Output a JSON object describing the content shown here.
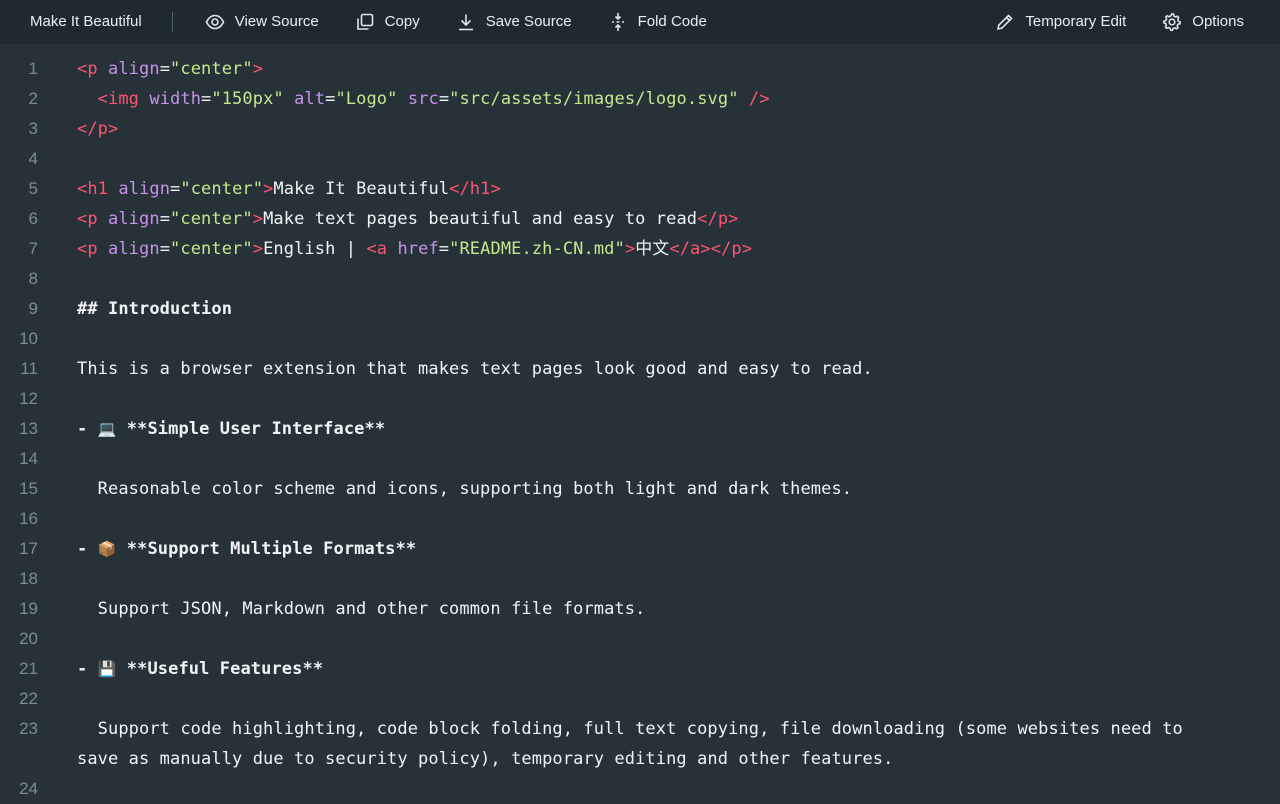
{
  "toolbar": {
    "brand": "Make It Beautiful",
    "view_source": "View Source",
    "copy": "Copy",
    "save_source": "Save Source",
    "fold_code": "Fold Code",
    "temporary_edit": "Temporary Edit",
    "options": "Options"
  },
  "lines": {
    "n1": "1",
    "n2": "2",
    "n3": "3",
    "n4": "4",
    "n5": "5",
    "n6": "6",
    "n7": "7",
    "n8": "8",
    "n9": "9",
    "n10": "10",
    "n11": "11",
    "n12": "12",
    "n13": "13",
    "n14": "14",
    "n15": "15",
    "n16": "16",
    "n17": "17",
    "n18": "18",
    "n19": "19",
    "n20": "20",
    "n21": "21",
    "n22": "22",
    "n23": "23",
    "n24": "24"
  },
  "code": {
    "l1": {
      "open": "<p",
      "a1": "align",
      "eq1": "=",
      "s1": "\"center\"",
      "close": ">"
    },
    "l2": {
      "indent": "  ",
      "open": "<img",
      "a1": "width",
      "s1": "\"150px\"",
      "a2": "alt",
      "s2": "\"Logo\"",
      "a3": "src",
      "s3": "\"src/assets/images/logo.svg\"",
      "close": "/>"
    },
    "l3": {
      "tag": "</p>"
    },
    "l5": {
      "open": "<h1",
      "a1": "align",
      "s1": "\"center\"",
      "gt": ">",
      "text": "Make It Beautiful",
      "close": "</h1>"
    },
    "l6": {
      "open": "<p",
      "a1": "align",
      "s1": "\"center\"",
      "gt": ">",
      "text": "Make text pages beautiful and easy to read",
      "close": "</p>"
    },
    "l7": {
      "open": "<p",
      "a1": "align",
      "s1": "\"center\"",
      "gt": ">",
      "text": "English | ",
      "a_open": "<a",
      "a_attr": "href",
      "a_str": "\"README.zh-CN.md\"",
      "a_gt": ">",
      "a_text": "中文",
      "a_close": "</a>",
      "close": "</p>"
    },
    "l9": "## Introduction",
    "l11": "This is a browser extension that makes text pages look good and easy to read.",
    "l13": {
      "dash": "- ",
      "emoji": "💻",
      "text": " **Simple User Interface**"
    },
    "l15": "  Reasonable color scheme and icons, supporting both light and dark themes.",
    "l17": {
      "dash": "- ",
      "emoji": "📦",
      "text": " **Support Multiple Formats**"
    },
    "l19": "  Support JSON, Markdown and other common file formats.",
    "l21": {
      "dash": "- ",
      "emoji": "💾",
      "text": " **Useful Features**"
    },
    "l23": "  Support code highlighting, code block folding, full text copying, file downloading (some websites need to save as manually due to security policy), temporary editing and other features."
  }
}
